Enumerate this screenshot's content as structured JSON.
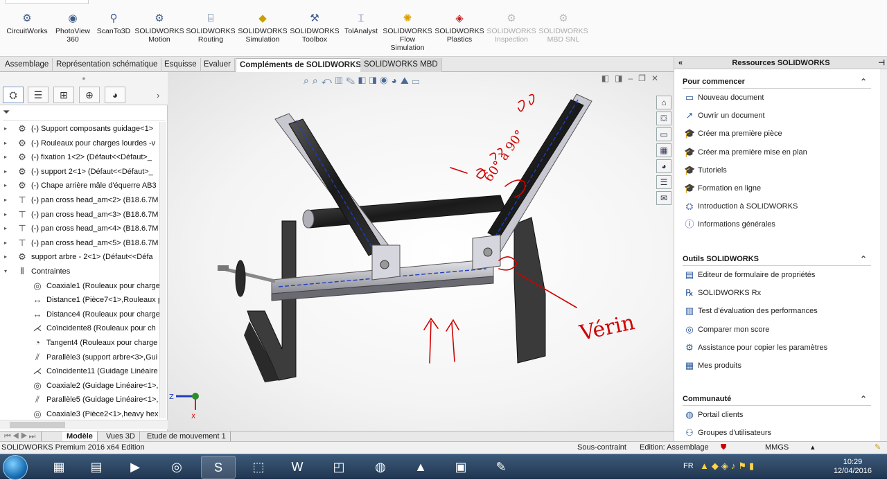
{
  "ribbon": {
    "items": [
      {
        "label": "CircuitWorks",
        "icon": "circuitworks-icon",
        "disabled": false
      },
      {
        "label": "PhotoView 360",
        "icon": "photoview-icon",
        "disabled": false
      },
      {
        "label": "ScanTo3D",
        "icon": "scanto3d-icon",
        "disabled": false
      },
      {
        "label": "SOLIDWORKS Motion",
        "icon": "motion-icon",
        "disabled": false
      },
      {
        "label": "SOLIDWORKS Routing",
        "icon": "routing-icon",
        "disabled": false
      },
      {
        "label": "SOLIDWORKS Simulation",
        "icon": "simulation-icon",
        "disabled": false
      },
      {
        "label": "SOLIDWORKS Toolbox",
        "icon": "toolbox-icon",
        "disabled": false
      },
      {
        "label": "TolAnalyst",
        "icon": "tolanalyst-icon",
        "disabled": false
      },
      {
        "label": "SOLIDWORKS Flow Simulation",
        "icon": "flow-simulation-icon",
        "disabled": false
      },
      {
        "label": "SOLIDWORKS Plastics",
        "icon": "plastics-icon",
        "disabled": false
      },
      {
        "label": "SOLIDWORKS Inspection",
        "icon": "inspection-icon",
        "disabled": true
      },
      {
        "label": "SOLIDWORKS MBD SNL",
        "icon": "mbd-snl-icon",
        "disabled": true
      }
    ]
  },
  "command_tabs": [
    "Assemblage",
    "Représentation schématique",
    "Esquisse",
    "Evaluer",
    "Compléments de SOLIDWORKS",
    "SOLIDWORKS MBD"
  ],
  "command_tabs_active": "Compléments de SOLIDWORKS",
  "tree": {
    "items": [
      {
        "label": "(-) Support composants guidage<1>",
        "icon": "component-icon",
        "indent": 0,
        "expander": "▸"
      },
      {
        "label": "(-) Rouleaux pour charges lourdes -v",
        "icon": "component-icon",
        "indent": 0,
        "expander": "▸"
      },
      {
        "label": "(-) fixation 1<2> (Défaut<<Défaut>_",
        "icon": "component-icon",
        "indent": 0,
        "expander": "▸"
      },
      {
        "label": "(-) support 2<1> (Défaut<<Défaut>_",
        "icon": "component-icon",
        "indent": 0,
        "expander": "▸"
      },
      {
        "label": "(-) Chape arrière mâle d'équerre AB3",
        "icon": "component-icon",
        "indent": 0,
        "expander": "▸"
      },
      {
        "label": "(-) pan cross head_am<2> (B18.6.7M",
        "icon": "screw-icon",
        "indent": 0,
        "expander": "▸"
      },
      {
        "label": "(-) pan cross head_am<3> (B18.6.7M",
        "icon": "screw-icon",
        "indent": 0,
        "expander": "▸"
      },
      {
        "label": "(-) pan cross head_am<4> (B18.6.7M",
        "icon": "screw-icon",
        "indent": 0,
        "expander": "▸"
      },
      {
        "label": "(-) pan cross head_am<5> (B18.6.7M",
        "icon": "screw-icon",
        "indent": 0,
        "expander": "▸"
      },
      {
        "label": "support arbre - 2<1> (Défaut<<Défa",
        "icon": "component-icon",
        "indent": 0,
        "expander": "▸"
      },
      {
        "label": "Contraintes",
        "icon": "mates-icon",
        "indent": 0,
        "expander": "▾"
      },
      {
        "label": "Coaxiale1 (Rouleaux pour charge",
        "icon": "coaxial-icon",
        "indent": 1,
        "expander": ""
      },
      {
        "label": "Distance1 (Pièce7<1>,Rouleaux p",
        "icon": "distance-icon",
        "indent": 1,
        "expander": ""
      },
      {
        "label": "Distance4 (Rouleaux pour charge",
        "icon": "distance-icon",
        "indent": 1,
        "expander": ""
      },
      {
        "label": "Coïncidente8 (Rouleaux pour ch",
        "icon": "coincident-icon",
        "indent": 1,
        "expander": ""
      },
      {
        "label": "Tangent4 (Rouleaux pour charge",
        "icon": "tangent-icon",
        "indent": 1,
        "expander": ""
      },
      {
        "label": "Parallèle3 (support arbre<3>,Gui",
        "icon": "parallel-icon",
        "indent": 1,
        "expander": ""
      },
      {
        "label": "Coïncidente11 (Guidage Linéaire",
        "icon": "coincident-icon",
        "indent": 1,
        "expander": ""
      },
      {
        "label": "Coaxiale2 (Guidage Linéaire<1>,",
        "icon": "coaxial-icon",
        "indent": 1,
        "expander": ""
      },
      {
        "label": "Parallèle5 (Guidage Linéaire<1>,",
        "icon": "parallel-icon",
        "indent": 1,
        "expander": ""
      },
      {
        "label": "Coaxiale3 (Pièce2<1>,heavy hex",
        "icon": "coaxial-icon",
        "indent": 1,
        "expander": ""
      }
    ]
  },
  "annotations": {
    "angle": "60° à 90°",
    "note": "Vérin",
    "arrows": "↑↑"
  },
  "triad": {
    "z": "Z",
    "x": "X"
  },
  "resources": {
    "title": "Ressources SOLIDWORKS",
    "sections": [
      {
        "title": "Pour commencer",
        "items": [
          {
            "label": "Nouveau document",
            "icon": "new-document-icon"
          },
          {
            "label": "Ouvrir un document",
            "icon": "open-document-icon"
          },
          {
            "label": "Créer ma première pièce",
            "icon": "tutorial-cap-icon"
          },
          {
            "label": "Créer ma première mise en plan",
            "icon": "tutorial-cap-icon"
          },
          {
            "label": "Tutoriels",
            "icon": "tutorial-cap-icon"
          },
          {
            "label": "Formation en ligne",
            "icon": "tutorial-cap-icon"
          },
          {
            "label": "Introduction à SOLIDWORKS",
            "icon": "intro-icon"
          },
          {
            "label": "Informations générales",
            "icon": "info-icon"
          }
        ]
      },
      {
        "title": "Outils SOLIDWORKS",
        "items": [
          {
            "label": "Editeur de formulaire de propriétés",
            "icon": "property-editor-icon"
          },
          {
            "label": "SOLIDWORKS Rx",
            "icon": "rx-icon"
          },
          {
            "label": "Test d'évaluation des performances",
            "icon": "performance-icon"
          },
          {
            "label": "Comparer mon score",
            "icon": "compare-score-icon"
          },
          {
            "label": "Assistance pour copier les paramètres",
            "icon": "copy-settings-icon"
          },
          {
            "label": "Mes produits",
            "icon": "products-icon"
          }
        ]
      },
      {
        "title": "Communauté",
        "items": [
          {
            "label": "Portail clients",
            "icon": "portal-icon"
          },
          {
            "label": "Groupes d'utilisateurs",
            "icon": "user-groups-icon"
          }
        ]
      }
    ]
  },
  "bottom_tabs": [
    "Modèle",
    "Vues 3D",
    "Etude de mouvement 1"
  ],
  "bottom_tabs_active": "Modèle",
  "status": {
    "edition": "SOLIDWORKS Premium 2016 x64 Edition",
    "constraint": "Sous-contraint",
    "mode": "Edition: Assemblage",
    "units": "MMGS"
  },
  "taskbar": {
    "lang": "FR",
    "time": "10:29",
    "date": "12/04/2016",
    "apps": [
      "calculator-icon",
      "explorer-icon",
      "media-icon",
      "chrome-icon",
      "solidworks-icon",
      "festo-icon",
      "word-icon",
      "office-icon",
      "network-icon",
      "vlc-icon",
      "photos-icon",
      "paint-icon"
    ]
  },
  "colors": {
    "annotation": "#d10000",
    "accent": "#2d5a9e",
    "cad_blue": "#1f3fbf"
  }
}
